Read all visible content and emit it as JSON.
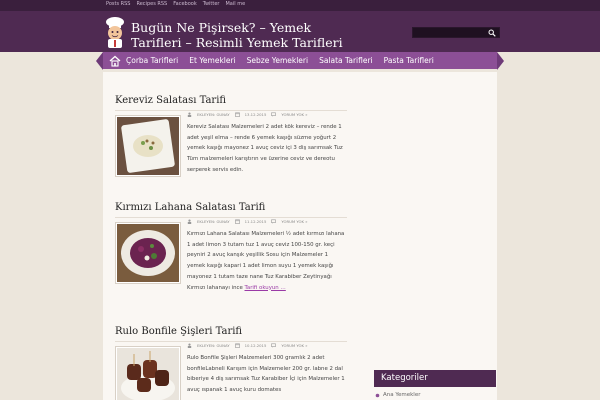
{
  "top_links": [
    "Posts RSS",
    "Recipes RSS",
    "Facebook",
    "Twitter",
    "Mail me"
  ],
  "site_title": "Bugün Ne Pişirsek? – Yemek Tarifleri – Resimli Yemek Tarifleri",
  "search": {
    "placeholder": ""
  },
  "nav_items": [
    "Çorba Tarifleri",
    "Et Yemekleri",
    "Sebze Yemekleri",
    "Salata Tarifleri",
    "Pasta Tarifleri"
  ],
  "posts": [
    {
      "title": "Kereviz Salatası Tarifi",
      "author": "EKLEYEN: GUNAY",
      "date": "13.12.2015",
      "comments": "YORUM YOK »",
      "excerpt": "Kereviz Salatası Malzemeleri 2 adet kök kereviz – rende 1 adet yeşil elma – rende 6 yemek kaşığı süzme yoğurt 2 yemek kaşığı mayonez 1 avuç ceviz içi 3 diş sarımsak Tuz Tüm malzemeleri karıştırın ve üzerine ceviz ve dereotu serperek servis edin.",
      "readmore": ""
    },
    {
      "title": "Kırmızı Lahana Salatası Tarifi",
      "author": "EKLEYEN: GUNAY",
      "date": "11.12.2015",
      "comments": "YORUM YOK »",
      "excerpt": "Kırmızı Lahana Salatası Malzemeleri ½ adet kırmızı lahana 1 adet limon 3 tutam tuz 1 avuç ceviz 100-150 gr. keçi peyniri 2 avuç kanşık yeşillik Sosu için Malzemeler 1 yemek kaşığı kapari 1 adet limon suyu 1 yemek kaşığı mayonez 1 tutam taze nane Tuz Karabiber Zeytinyağı Kırmızı lahanayı ince ",
      "readmore": "Tarifi okuyun …"
    },
    {
      "title": "Rulo Bonfile Şişleri Tarifi",
      "author": "EKLEYEN: GUNAY",
      "date": "10.12.2015",
      "comments": "YORUM YOK »",
      "excerpt": "Rulo Bonfile Şişleri Malzemeleri 300 gramlık 2 adet bonfileLabneli Karışım için Malzemeler 200 gr. labne 2 dal biberiye 4 diş sarımsak Tuz Karabiber İçi için Malzemeler 1 avuç ıspanak 1 avuç kuru domates",
      "readmore": ""
    }
  ],
  "sidebar": {
    "widget_title": "Kategoriler",
    "items": [
      "Ana Yemekler"
    ]
  },
  "colors": {
    "header": "#4f2a52",
    "nav": "#8c4f96",
    "accent": "#9a3aa6",
    "background": "#ece6dc"
  }
}
